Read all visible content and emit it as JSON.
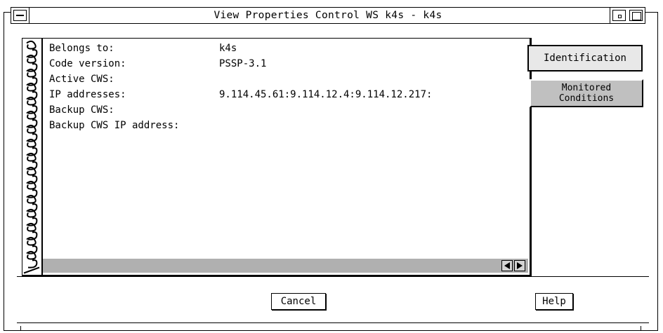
{
  "window": {
    "title": "View Properties Control WS k4s - k4s"
  },
  "properties": [
    {
      "label": "Belongs to:",
      "value": "k4s"
    },
    {
      "label": "Code version:",
      "value": "PSSP-3.1"
    },
    {
      "label": "Active CWS:",
      "value": ""
    },
    {
      "label": "IP addresses:",
      "value": "9.114.45.61:9.114.12.4:9.114.12.217:"
    },
    {
      "label": "Backup CWS:",
      "value": ""
    },
    {
      "label": "Backup CWS IP address:",
      "value": ""
    }
  ],
  "tabs": {
    "identification": "Identification",
    "monitored_line1": "Monitored",
    "monitored_line2": "Conditions"
  },
  "buttons": {
    "cancel": "Cancel",
    "help": "Help"
  }
}
